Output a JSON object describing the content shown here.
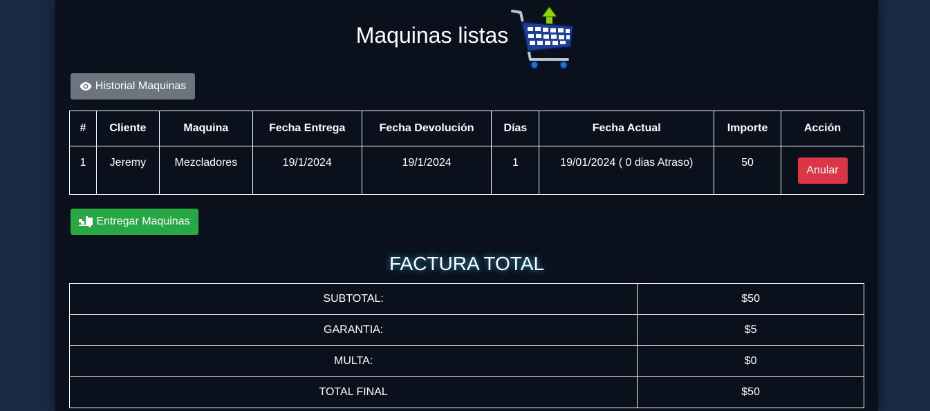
{
  "header": {
    "title": "Maquinas listas",
    "cart_icon": "shopping-cart-upload-icon"
  },
  "history_button": {
    "label": "Historial Maquinas",
    "icon": "eye-icon",
    "color": "#6c757d"
  },
  "machines_table": {
    "columns": [
      "#",
      "Cliente",
      "Maquina",
      "Fecha Entrega",
      "Fecha Devolución",
      "Días",
      "Fecha Actual",
      "Importe",
      "Acción"
    ],
    "rows": [
      {
        "num": "1",
        "cliente": "Jeremy",
        "maquina": "Mezcladores",
        "fecha_entrega": "19/1/2024",
        "fecha_devolucion": "19/1/2024",
        "dias": "1",
        "fecha_actual": "19/01/2024 ( 0 dias Atraso)",
        "importe": "50",
        "action_label": "Anular"
      }
    ]
  },
  "deliver_button": {
    "label": "Entregar Maquinas",
    "icon": "truck-loading-icon",
    "color": "#28a745"
  },
  "factura": {
    "title": "FACTURA TOTAL",
    "rows": [
      {
        "label": "SUBTOTAL:",
        "value": "$50"
      },
      {
        "label": "GARANTIA:",
        "value": "$5"
      },
      {
        "label": "MULTA:",
        "value": "$0"
      },
      {
        "label": "TOTAL FINAL",
        "value": "$50"
      }
    ]
  },
  "colors": {
    "background": "#1b2a45",
    "panel": "#0b111c",
    "danger": "#dc3545"
  }
}
